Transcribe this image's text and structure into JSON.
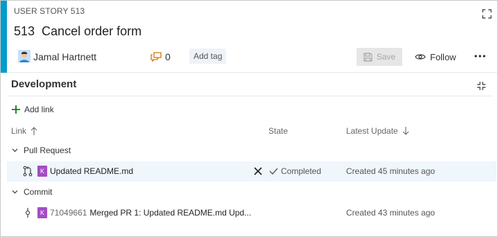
{
  "work_item": {
    "type_label": "USER STORY 513",
    "id": "513",
    "title": "Cancel order form",
    "assignee": "Jamal Hartnett",
    "comment_count": "0",
    "add_tag_label": "Add tag",
    "accent_color": "#009ccc"
  },
  "toolbar": {
    "save_label": "Save",
    "follow_label": "Follow"
  },
  "development": {
    "section_title": "Development",
    "add_link_label": "Add link",
    "columns": {
      "link": "Link",
      "state": "State",
      "latest_update": "Latest Update"
    },
    "groups": [
      {
        "name": "Pull Request",
        "items": [
          {
            "badge": "K",
            "text": "Updated README.md",
            "state": "Completed",
            "latest_update": "Created 45 minutes ago"
          }
        ]
      },
      {
        "name": "Commit",
        "items": [
          {
            "badge": "K",
            "commit_id": "71049661",
            "text": "Merged PR 1: Updated README.md Upd...",
            "latest_update": "Created 43 minutes ago"
          }
        ]
      }
    ]
  },
  "colors": {
    "badge": "#a44cc3",
    "add_link_plus": "#107c10",
    "comment_icon": "#d47500",
    "selected_row": "#eff6fc"
  }
}
